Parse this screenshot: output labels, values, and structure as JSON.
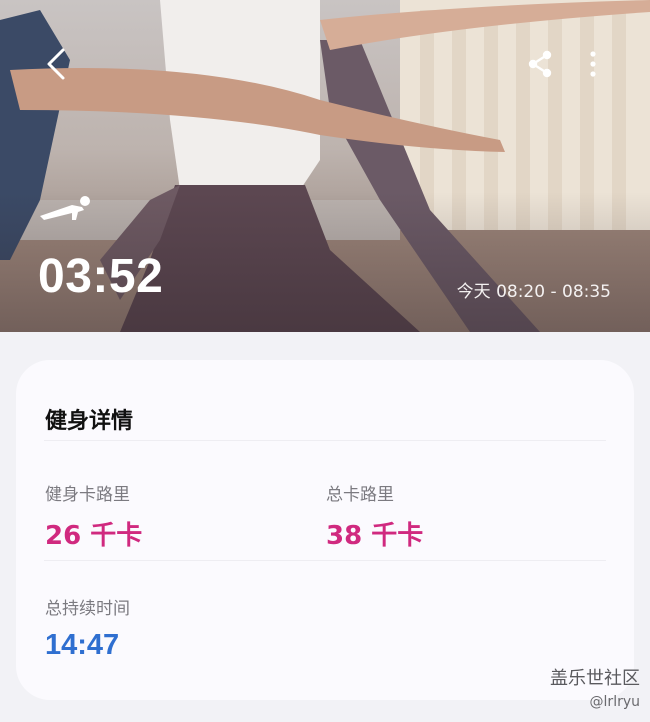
{
  "hero": {
    "duration": "03:52",
    "time_range": "今天 08:20 - 08:35",
    "workout_icon": "plank-exercise-icon"
  },
  "nav": {
    "back_icon": "back-arrow-icon",
    "share_icon": "share-icon",
    "more_icon": "more-vertical-icon"
  },
  "details": {
    "title": "健身详情",
    "metrics": [
      {
        "label": "健身卡路里",
        "value": "26 千卡",
        "color": "#d0297f"
      },
      {
        "label": "总卡路里",
        "value": "38 千卡",
        "color": "#d0297f"
      },
      {
        "label": "总持续时间",
        "value": "14:47",
        "color": "#2f6fd0"
      }
    ]
  },
  "watermark": {
    "main": "盖乐世社区",
    "sub": "@lrlryu"
  }
}
